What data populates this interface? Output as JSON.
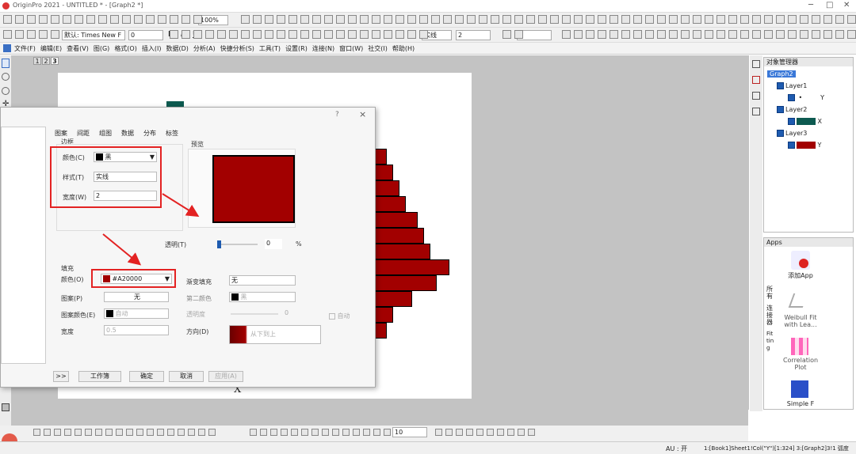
{
  "window": {
    "title": "OriginPro 2021 - UNTITLED * - [Graph2 *]"
  },
  "toolbar": {
    "zoom": "100%",
    "font_name": "默认: Times New F",
    "font_size": "0",
    "line_style": "实线",
    "line_width": "2",
    "fill_size": "0"
  },
  "menubar": {
    "items": [
      "文件(F)",
      "编辑(E)",
      "查看(V)",
      "图(G)",
      "格式(O)",
      "插入(I)",
      "数据(D)",
      "分析(A)",
      "快捷分析(S)",
      "工具(T)",
      "设置(R)",
      "连接(N)",
      "窗口(W)",
      "社交(I)",
      "帮助(H)"
    ]
  },
  "pagetabs": [
    "1",
    "2",
    "3"
  ],
  "graph": {
    "xlabel": "X",
    "bar_color": "#A20000",
    "bar_values": [
      2,
      3,
      4,
      5,
      7,
      8,
      9,
      12,
      10,
      6,
      3,
      2
    ]
  },
  "dialog": {
    "close": "×",
    "help": "?",
    "tabs": [
      "图案",
      "间距",
      "组图",
      "数据",
      "分布",
      "标签"
    ],
    "border_group": "边框",
    "preview_label": "预览",
    "border_color_label": "颜色(C)",
    "border_color_value": "黑",
    "border_style_label": "样式(T)",
    "border_style_value": "实线",
    "border_width_label": "宽度(W)",
    "border_width_value": "2",
    "transparency_label": "透明(T)",
    "transparency_value": "0",
    "transparency_unit": "%",
    "fill_group": "填充",
    "fill_color_label": "颜色(O)",
    "fill_color_value": "#A20000",
    "pattern_label": "图案(P)",
    "pattern_value": "无",
    "pattern_color_label": "图案颜色(E)",
    "pattern_color_value": "自动",
    "pattern_width_label": "宽度",
    "pattern_width_value": "0.5",
    "gradient_label": "渐变填充",
    "gradient_value": "无",
    "second_color_label": "第二颜色",
    "second_color_value": "黑",
    "grad_trans_label": "透明度",
    "grad_trans_value": "0",
    "auto_label": "自动",
    "direction_label": "方向(D)",
    "direction_value": "从下到上",
    "buttons": {
      "expand": ">>",
      "workbook": "工作簿",
      "ok": "确定",
      "cancel": "取消",
      "apply": "应用(A)"
    }
  },
  "object_manager": {
    "title": "对象管理器",
    "graph": "Graph2",
    "layers": [
      {
        "name": "Layer1",
        "plot": "Y"
      },
      {
        "name": "Layer2",
        "plot": "X"
      },
      {
        "name": "Layer3",
        "plot": "Y"
      }
    ]
  },
  "apps": {
    "title": "Apps",
    "items": [
      "添加App",
      "Weibull Fit with Lea...",
      "Correlation Plot",
      "Simple F"
    ],
    "side_tabs": [
      "所有",
      "连接器",
      "Fitting"
    ]
  },
  "bottom_toolbar": {
    "size": "10"
  },
  "status": {
    "au": "AU : 开",
    "info": "1:[Book1]Sheet1!Col(\"Y\")[1:324]  3:[Graph2]3!1  弧度"
  },
  "colors": {
    "accent": "#A20000",
    "highlight": "#E32222",
    "selection": "#1E5BB0"
  }
}
